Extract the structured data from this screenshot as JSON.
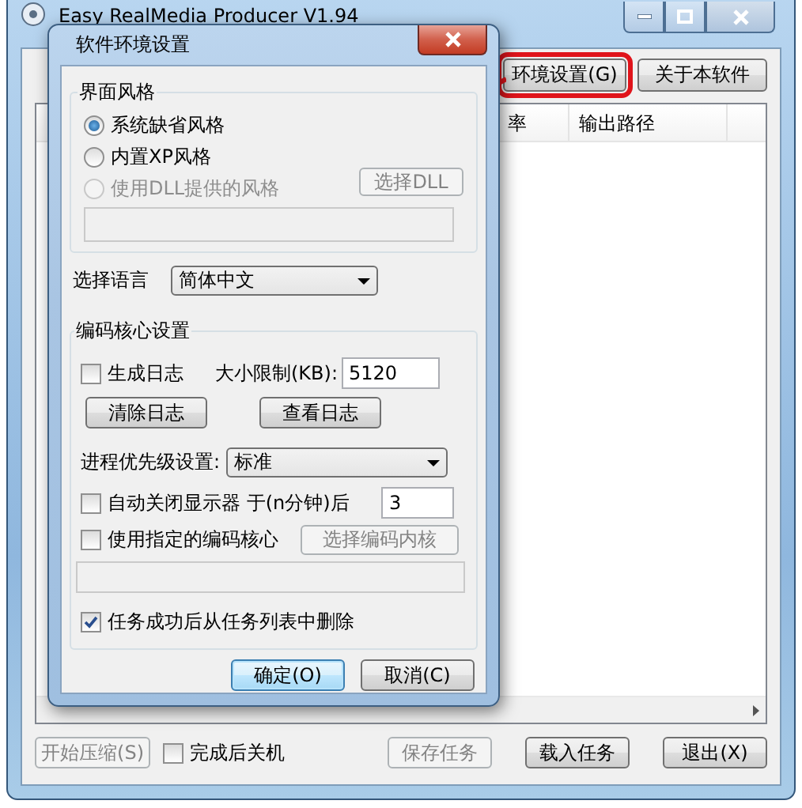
{
  "main_window": {
    "title": "Easy RealMedia Producer V1.94",
    "toolbar_buttons": [
      {
        "label": "环境设置(G)",
        "annotated": true
      },
      {
        "label": "关于本软件",
        "annotated": false
      }
    ],
    "list": {
      "columns": [
        "率",
        "输出路径"
      ]
    },
    "start_button": {
      "label": "开始压缩(S)",
      "disabled": true
    },
    "shutdown_checkbox": {
      "label": "完成后关机",
      "checked": false
    },
    "bottom_buttons": [
      {
        "label": "保存任务",
        "disabled": true
      },
      {
        "label": "载入任务",
        "disabled": false
      },
      {
        "label": "退出(X)",
        "disabled": false
      }
    ]
  },
  "dialog": {
    "title": "软件环境设置",
    "style_group": {
      "title": "界面风格",
      "options": [
        {
          "label": "系统缺省风格",
          "selected": true,
          "disabled": false
        },
        {
          "label": "内置XP风格",
          "selected": false,
          "disabled": false
        },
        {
          "label": "使用DLL提供的风格",
          "selected": false,
          "disabled": true
        }
      ],
      "dll_button": {
        "label": "选择DLL",
        "disabled": true
      }
    },
    "language": {
      "label": "选择语言",
      "value": "简体中文"
    },
    "core_group": {
      "title": "编码核心设置",
      "log_checkbox": {
        "label": "生成日志",
        "checked": false
      },
      "size_limit": {
        "label": "大小限制(KB):",
        "value": "5120"
      },
      "log_buttons": [
        {
          "label": "清除日志",
          "disabled": false
        },
        {
          "label": "查看日志",
          "disabled": false
        }
      ],
      "priority": {
        "label": "进程优先级设置:",
        "value": "标准"
      },
      "monitor_checkbox": {
        "label": "自动关闭显示器 于(n分钟)后",
        "checked": false,
        "value": "3"
      },
      "core_checkbox": {
        "label": "使用指定的编码核心",
        "checked": false
      },
      "core_button": {
        "label": "选择编码内核",
        "disabled": true
      },
      "remove_checkbox": {
        "label": "任务成功后从任务列表中删除",
        "checked": true
      }
    },
    "buttons": [
      {
        "label": "确定(O)",
        "default": true
      },
      {
        "label": "取消(C)",
        "default": false
      }
    ]
  }
}
